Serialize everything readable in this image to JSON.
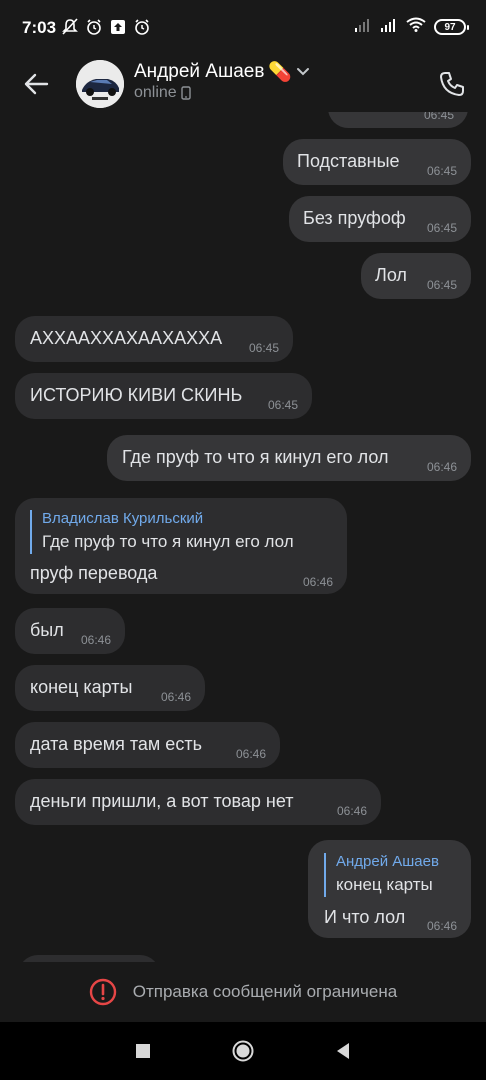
{
  "status_bar": {
    "time": "7:03",
    "battery": "97",
    "icons_left": [
      "notifications-off-icon",
      "alarm-icon",
      "upload-icon",
      "alarm-clock-icon"
    ],
    "icons_right": [
      "signal-icon",
      "signal-icon",
      "wifi-icon",
      "battery-icon"
    ]
  },
  "header": {
    "name": "Андрей Ашаев",
    "emoji": "💊",
    "status": "online",
    "icons": [
      "back-arrow-icon",
      "avatar",
      "chevron-down-icon",
      "phone-small-icon",
      "phone-call-icon"
    ]
  },
  "messages": [
    {
      "dir": "out",
      "text": "Подставные",
      "time": "06:45"
    },
    {
      "dir": "out",
      "text": "Без пруфоф",
      "time": "06:45"
    },
    {
      "dir": "out",
      "text": "Лол",
      "time": "06:45"
    },
    {
      "dir": "in",
      "text": "АХХААХХАХААХАХХА",
      "time": "06:45"
    },
    {
      "dir": "in",
      "text": "ИСТОРИЮ КИВИ СКИНЬ",
      "time": "06:45"
    },
    {
      "dir": "out",
      "text": "Где пруф то что я кинул его лол",
      "time": "06:46"
    },
    {
      "dir": "in",
      "reply_name": "Владислав Курильский",
      "reply_text": "Где пруф то что я кинул его лол",
      "text": "пруф перевода",
      "time": "06:46"
    },
    {
      "dir": "in",
      "text": "был",
      "time": "06:46"
    },
    {
      "dir": "in",
      "text": "конец карты",
      "time": "06:46"
    },
    {
      "dir": "in",
      "text": "дата время там есть",
      "time": "06:46"
    },
    {
      "dir": "in",
      "text": "деньги пришли, а вот товар нет",
      "time": "06:46"
    },
    {
      "dir": "out",
      "reply_name": "Андрей Ашаев",
      "reply_text": "конец карты",
      "text": "И что лол",
      "time": "06:46"
    }
  ],
  "partial_top_time": "06:45",
  "footer": {
    "text": "Отправка сообщений ограничена",
    "icon": "alert-circle-icon"
  },
  "nav": [
    "recents-square-icon",
    "home-circle-icon",
    "back-triangle-icon"
  ],
  "colors": {
    "background": "#191919",
    "bubble_in": "#2d2d2f",
    "bubble_out": "#363638",
    "reply_accent": "#71aaeb",
    "alert_red": "#e64646"
  }
}
